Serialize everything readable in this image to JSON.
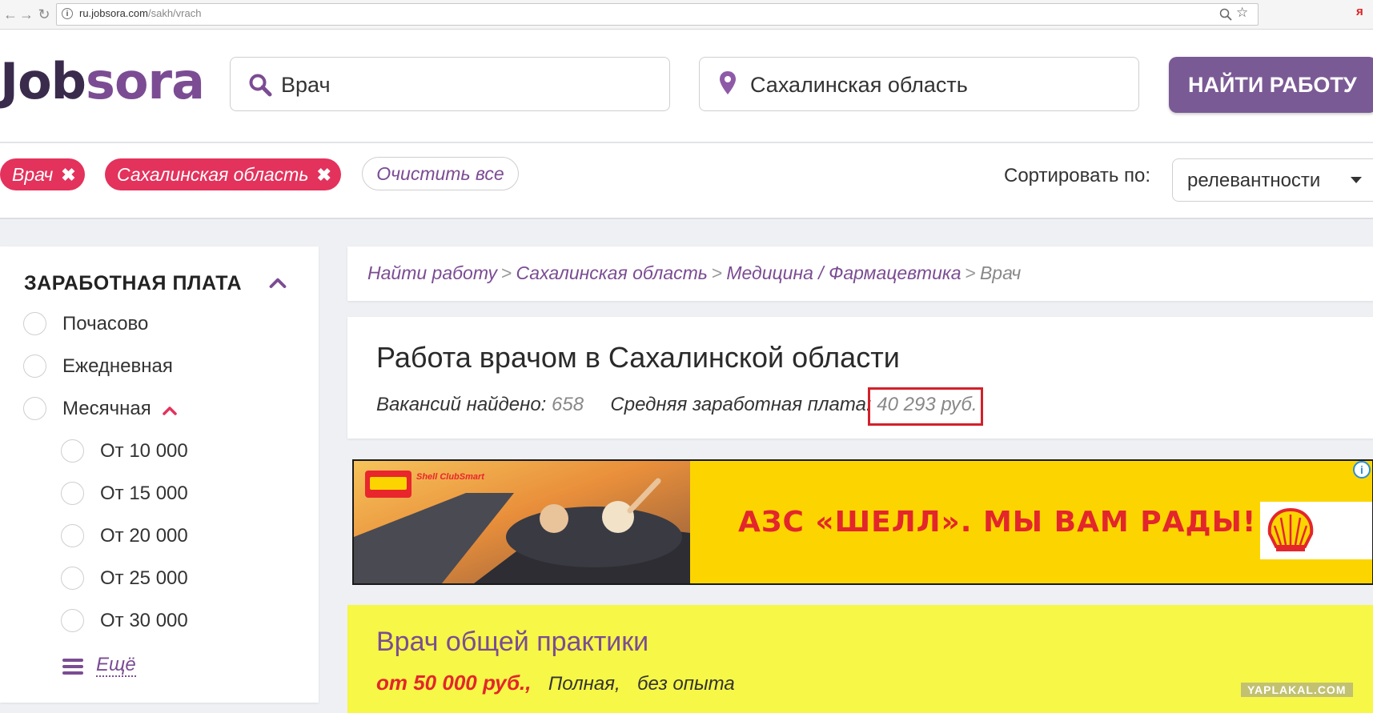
{
  "browser": {
    "url_host": "ru.jobsora.com",
    "url_path": "/sakh/vrach"
  },
  "header": {
    "logo_main": "Job",
    "logo_accent": "sora",
    "logo_prefix": "J",
    "search_query": "Врач",
    "location": "Сахалинская область",
    "find_button": "НАЙТИ РАБОТУ"
  },
  "filters": {
    "chips": [
      {
        "label": "Врач"
      },
      {
        "label": "Сахалинская область"
      }
    ],
    "clear_all": "Очистить все",
    "sort_label": "Сортировать по:",
    "sort_value": "релевантности"
  },
  "sidebar": {
    "title": "ЗАРАБОТНАЯ ПЛАТА",
    "options": [
      {
        "label": "Почасово"
      },
      {
        "label": "Ежедневная"
      },
      {
        "label": "Месячная"
      }
    ],
    "monthly_options": [
      {
        "label": "От 10 000"
      },
      {
        "label": "От 15 000"
      },
      {
        "label": "От 20 000"
      },
      {
        "label": "От 25 000"
      },
      {
        "label": "От 30 000"
      }
    ],
    "more": "Ещё"
  },
  "breadcrumb": {
    "items": [
      "Найти работу",
      "Сахалинская область",
      "Медицина / Фармацевтика"
    ],
    "current": "Врач"
  },
  "results": {
    "title": "Работа врачом в Сахалинской области",
    "found_label": "Вакансий найдено:",
    "found_count": "658",
    "avg_salary_label": "Средняя заработная плата:",
    "avg_salary_value": "40 293 руб."
  },
  "ad": {
    "text": "АЗС «ШЕЛЛ». МЫ ВАМ РАДЫ!",
    "card_brand": "Shell ClubSmart",
    "info_icon": "i"
  },
  "job": {
    "title": "Врач общей практики",
    "salary": "от 50 000 руб.,",
    "employment": "Полная,",
    "experience": "без опыта"
  },
  "watermark": "YAPLAKAL.COM",
  "colors": {
    "brand_purple": "#7b4c93",
    "chip_red": "#e3325c",
    "button_purple": "#7a5a95",
    "highlight_red": "#d3202a",
    "ad_yellow": "#fcd500",
    "job_card_yellow": "#f6f746"
  },
  "icons": {
    "search": "magnifier-icon",
    "location": "map-pin-icon",
    "collapse": "chevron-up-icon",
    "more": "hamburger-icon"
  }
}
